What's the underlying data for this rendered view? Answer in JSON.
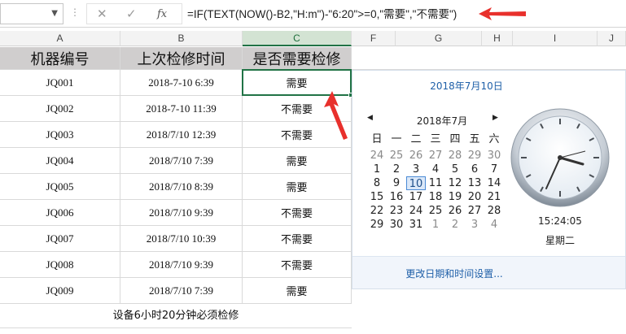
{
  "formula_bar": {
    "cancel_icon": "✕",
    "enter_icon": "✓",
    "function_label": "fx",
    "formula": "=IF(TEXT(NOW()-B2,\"H:m\")-\"6:20\">=0,\"需要\",\"不需要\")"
  },
  "columns": [
    "A",
    "B",
    "C",
    "F",
    "G",
    "H",
    "I",
    "J"
  ],
  "header_row": {
    "a": "机器编号",
    "b": "上次检修时间",
    "c": "是否需要检修"
  },
  "rows": [
    {
      "id": "JQ001",
      "time": "2018-7-10 6:39",
      "status": "需要"
    },
    {
      "id": "JQ002",
      "time": "2018-7-10 11:39",
      "status": "不需要"
    },
    {
      "id": "JQ003",
      "time": "2018/7/10 12:39",
      "status": "不需要"
    },
    {
      "id": "JQ004",
      "time": "2018/7/10 7:39",
      "status": "需要"
    },
    {
      "id": "JQ005",
      "time": "2018/7/10 8:39",
      "status": "需要"
    },
    {
      "id": "JQ006",
      "time": "2018/7/10 9:39",
      "status": "不需要"
    },
    {
      "id": "JQ007",
      "time": "2018/7/10 10:39",
      "status": "不需要"
    },
    {
      "id": "JQ008",
      "time": "2018/7/10 9:39",
      "status": "不需要"
    },
    {
      "id": "JQ009",
      "time": "2018/7/10 7:39",
      "status": "需要"
    }
  ],
  "note": "设备6小时20分钟必须检修",
  "clock_popup": {
    "date_link": "2018年7月10日",
    "month_title": "2018年7月",
    "prev_icon": "◀",
    "next_icon": "▶",
    "weekdays": [
      "日",
      "一",
      "二",
      "三",
      "四",
      "五",
      "六"
    ],
    "days": [
      [
        "24",
        "25",
        "26",
        "27",
        "28",
        "29",
        "30"
      ],
      [
        "1",
        "2",
        "3",
        "4",
        "5",
        "6",
        "7"
      ],
      [
        "8",
        "9",
        "10",
        "11",
        "12",
        "13",
        "14"
      ],
      [
        "15",
        "16",
        "17",
        "18",
        "19",
        "20",
        "21"
      ],
      [
        "22",
        "23",
        "24",
        "25",
        "26",
        "27",
        "28"
      ],
      [
        "29",
        "30",
        "31",
        "1",
        "2",
        "3",
        "4"
      ]
    ],
    "today": "10",
    "time": "15:24:05",
    "weekday": "星期二",
    "settings_link": "更改日期和时间设置...",
    "accent_color": "#1e5fa8",
    "arrow_color": "#e8302c"
  }
}
